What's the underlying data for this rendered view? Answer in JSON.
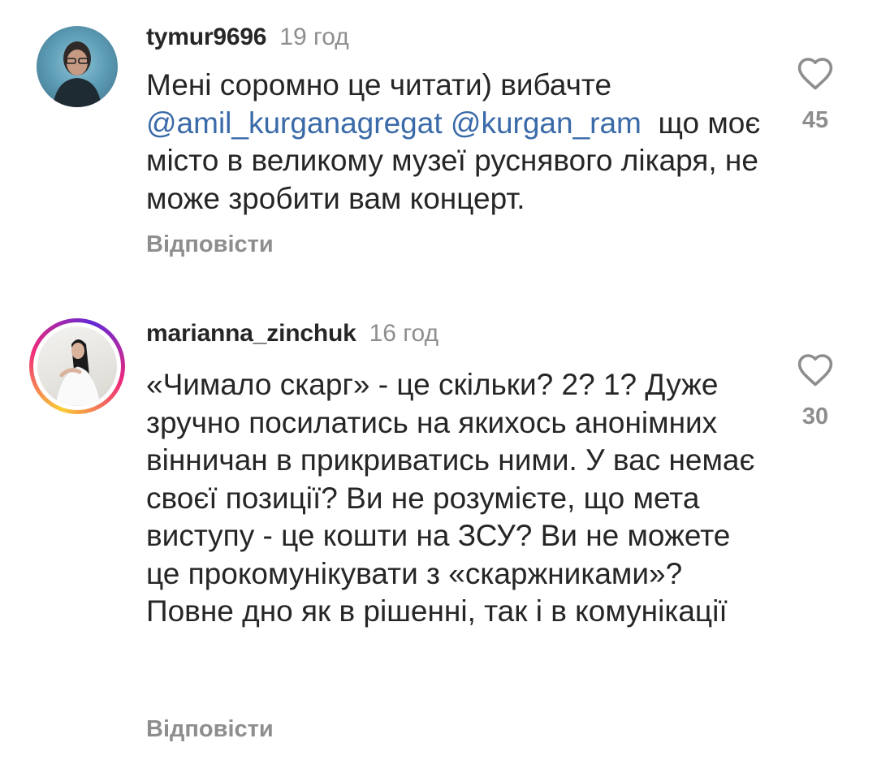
{
  "comments": [
    {
      "username": "tymur9696",
      "time": "19 год",
      "text_before": "Мені соромно це читати) вибачте",
      "mention1": "@amil_kurganagregat",
      "mention2": "@kurgan_ram",
      "text_after": "що моє місто в великому музеї руснявого лікаря, не може зробити вам концерт.",
      "likes": "45",
      "reply_label": "Відповісти"
    },
    {
      "username": "marianna_zinchuk",
      "time": "16 год",
      "text": "«Чимало скарг» - це скільки? 2? 1? Дуже зручно посилатись на якихось анонімних вінничан в прикриватись ними. У вас немає своєї позиції? Ви не розумієте, що мета виступу - це кошти на ЗСУ? Ви не можете це прокомунікувати з «скаржниками»? Повне дно як в рішенні, так і в комунікації",
      "likes": "30",
      "reply_label": "Відповісти"
    }
  ],
  "icons": {
    "like": "heart-outline-icon"
  },
  "colors": {
    "mention": "#3a6aa8",
    "muted": "#8e8e8e",
    "text": "#262626"
  }
}
